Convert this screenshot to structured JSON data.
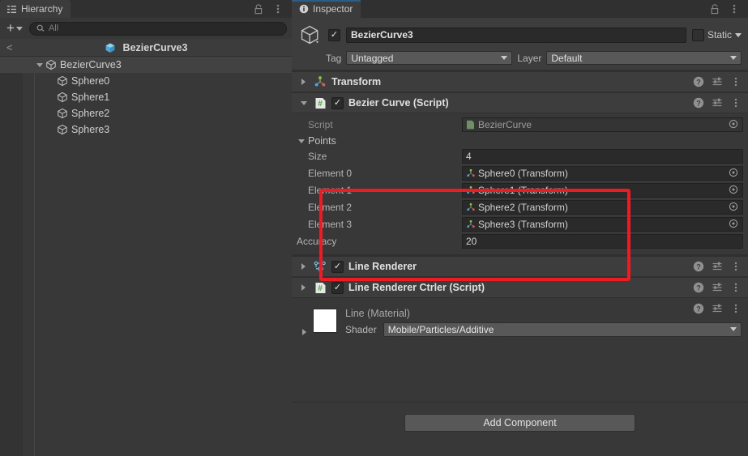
{
  "hierarchy": {
    "tab_label": "Hierarchy",
    "tab_icon": "hierarchy-icon",
    "lock_icon": "lock-icon",
    "menu_icon": "kebab-menu-icon",
    "add_button_label": "+",
    "search_placeholder": "All",
    "search_value": "",
    "breadcrumb": {
      "back_label": "<",
      "title": "BezierCurve3"
    },
    "tree": [
      {
        "label": "BezierCurve3",
        "depth": 0,
        "expanded": true,
        "selected": true
      },
      {
        "label": "Sphere0",
        "depth": 1,
        "expanded": false,
        "selected": false
      },
      {
        "label": "Sphere1",
        "depth": 1,
        "expanded": false,
        "selected": false
      },
      {
        "label": "Sphere2",
        "depth": 1,
        "expanded": false,
        "selected": false
      },
      {
        "label": "Sphere3",
        "depth": 1,
        "expanded": false,
        "selected": false
      }
    ]
  },
  "inspector": {
    "tab_label": "Inspector",
    "tab_icon": "info-icon",
    "lock_icon": "lock-icon",
    "menu_icon": "kebab-menu-icon",
    "gameobject": {
      "enabled": true,
      "name": "BezierCurve3",
      "static_enabled": false,
      "static_label": "Static",
      "tag_label": "Tag",
      "tag_value": "Untagged",
      "layer_label": "Layer",
      "layer_value": "Default"
    },
    "components": [
      {
        "name": "Transform",
        "icon": "transform-icon",
        "expanded": false,
        "has_toggle": false,
        "enabled": null
      },
      {
        "name": "Bezier Curve (Script)",
        "icon": "script-icon",
        "expanded": true,
        "has_toggle": true,
        "enabled": true
      },
      {
        "name": "Line Renderer",
        "icon": "line-renderer-icon",
        "expanded": false,
        "has_toggle": true,
        "enabled": true
      },
      {
        "name": "Line Renderer Ctrler (Script)",
        "icon": "script-icon",
        "expanded": false,
        "has_toggle": true,
        "enabled": true
      }
    ],
    "bezier_curve": {
      "script_label": "Script",
      "script_value": "BezierCurve",
      "points_label": "Points",
      "size_label": "Size",
      "size_value": "4",
      "elements": [
        {
          "label": "Element 0",
          "value": "Sphere0 (Transform)"
        },
        {
          "label": "Element 1",
          "value": "Sphere1 (Transform)"
        },
        {
          "label": "Element 2",
          "value": "Sphere2 (Transform)"
        },
        {
          "label": "Element 3",
          "value": "Sphere3 (Transform)"
        }
      ],
      "accuracy_label": "Accuracy",
      "accuracy_value": "20"
    },
    "material": {
      "title": "Line (Material)",
      "swatch_color": "#ffffff",
      "shader_label": "Shader",
      "shader_value": "Mobile/Particles/Additive"
    },
    "add_component_label": "Add Component"
  },
  "annotation": {
    "highlight_color": "#ec1c24",
    "highlight_target": "points-elements-array"
  },
  "icons": {
    "help": "help-icon",
    "preset": "preset-icon",
    "kebab": "kebab-menu-icon",
    "target_select": "object-picker-icon"
  }
}
